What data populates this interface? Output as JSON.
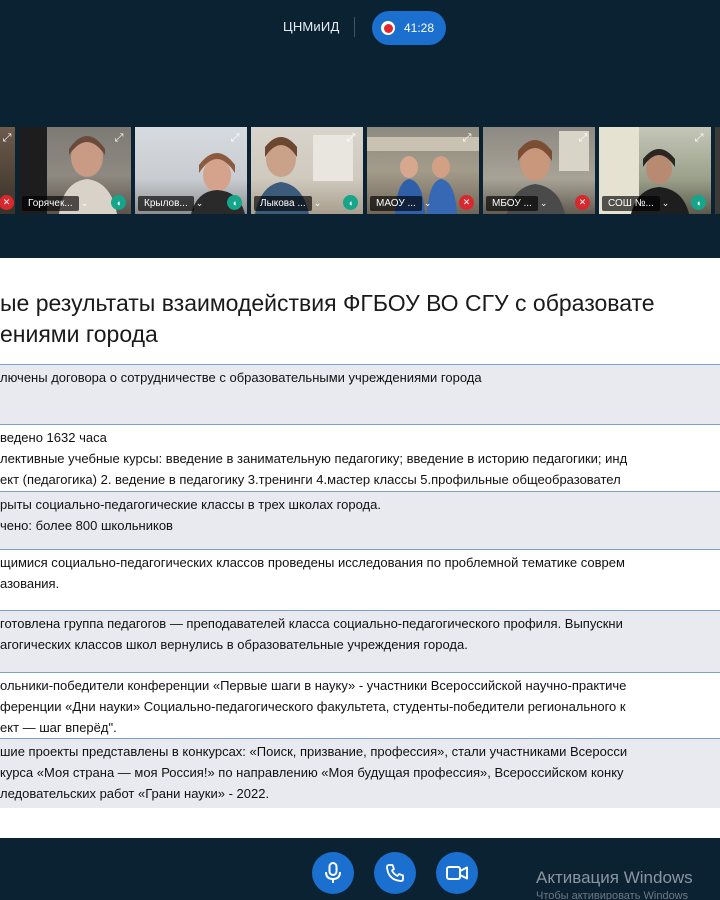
{
  "header": {
    "org_name": "ЦНМиИД",
    "recording_time": "41:28"
  },
  "participants": [
    {
      "name": "",
      "mic": "muted"
    },
    {
      "name": "Горячек...",
      "mic": "active"
    },
    {
      "name": "Крылов...",
      "mic": "active"
    },
    {
      "name": "Лыкова ...",
      "mic": "active"
    },
    {
      "name": "МАОУ ...",
      "mic": "muted"
    },
    {
      "name": "МБОУ ...",
      "mic": "muted"
    },
    {
      "name": "СОШ №...",
      "mic": "active"
    }
  ],
  "slide": {
    "title_line1": "ые результаты взаимодействия ФГБОУ ВО СГУ с образовате",
    "title_line2": "ениями города",
    "rows": [
      {
        "lines": [
          "лючены договора о сотрудничестве с образовательными учреждениями города"
        ]
      },
      {
        "lines": [
          "ведено 1632 часа",
          "лективные учебные курсы: введение в занимательную педагогику; введение в историю педагогики; инд",
          "ект (педагогика) 2. ведение в педагогику 3.тренинги 4.мастер классы 5.профильные общеобразовател"
        ]
      },
      {
        "lines": [
          "рыты социально-педагогические классы в трех школах города.",
          "чено: более 800 школьников"
        ]
      },
      {
        "lines": [
          "щимися социально-педагогических классов проведены исследования по проблемной тематике соврем",
          "азования."
        ]
      },
      {
        "lines": [
          "готовлена группа педагогов — преподавателей класса социально-педагогического профиля. Выпускни",
          "агогических классов школ вернулись в образовательные учреждения города."
        ]
      },
      {
        "lines": [
          "ольники-победители конференции «Первые шаги в науку» - участники Всероссийской  научно-практиче",
          "ференции «Дни науки» Социально-педагогического факультета, студенты-победители регионального к",
          "ект — шаг вперёд\"."
        ]
      },
      {
        "lines": [
          "шие проекты представлены в конкурсах: «Поиск, призвание, профессия», стали участниками Всеросси",
          "курса «Моя страна — моя Россия!» по направлению «Моя будущая  профессия», Всероссийском конку",
          "ледовательских работ «Грани науки» - 2022."
        ]
      }
    ]
  },
  "controls": {
    "mic": "microphone-icon",
    "phone": "phone-icon",
    "camera": "camera-icon"
  },
  "watermark": {
    "line1": "Активация Windows",
    "line2": "Чтобы активировать Windows"
  },
  "colors": {
    "accent": "#1b6fcf",
    "record": "#e2262d",
    "background": "#0b2233",
    "mute_badge": "#d9272e",
    "audio_badge": "#14a58a"
  }
}
